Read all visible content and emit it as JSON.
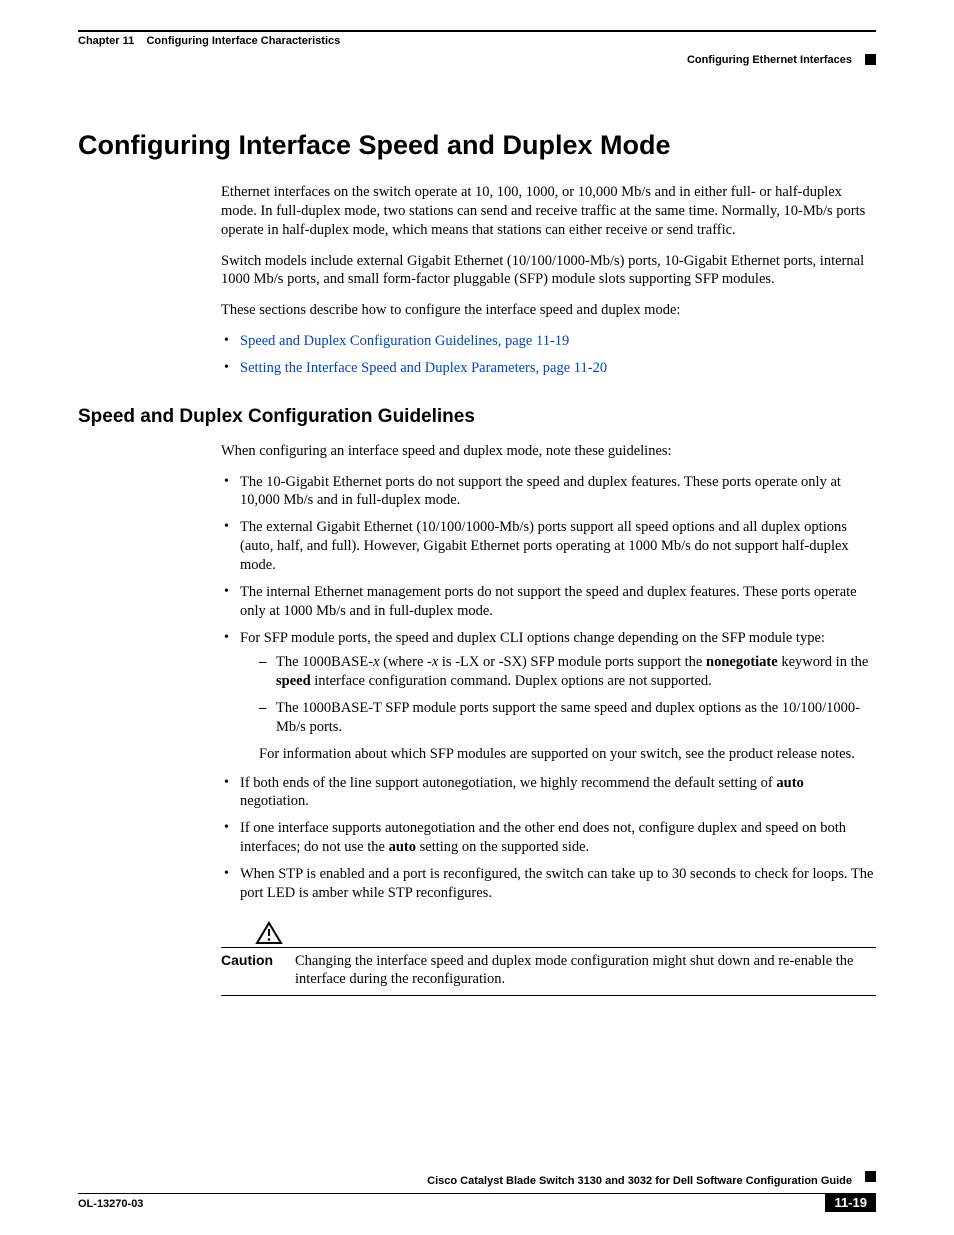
{
  "header": {
    "chapter_label": "Chapter 11",
    "chapter_title": "Configuring Interface Characteristics",
    "section_right": "Configuring Ethernet Interfaces"
  },
  "h1": "Configuring Interface Speed and Duplex Mode",
  "intro": {
    "p1": "Ethernet interfaces on the switch operate at 10, 100, 1000, or 10,000 Mb/s and in either full- or half-duplex mode. In full-duplex mode, two stations can send and receive traffic at the same time. Normally, 10-Mb/s ports operate in half-duplex mode, which means that stations can either receive or send traffic.",
    "p2": "Switch models include external Gigabit Ethernet (10/100/1000-Mb/s) ports, 10-Gigabit Ethernet ports, internal 1000 Mb/s ports, and small form-factor pluggable (SFP) module slots supporting SFP modules.",
    "p3": "These sections describe how to configure the interface speed and duplex mode:",
    "links": [
      "Speed and Duplex Configuration Guidelines, page 11-19",
      "Setting the Interface Speed and Duplex Parameters, page 11-20"
    ]
  },
  "h2": "Speed and Duplex Configuration Guidelines",
  "guide": {
    "intro": "When configuring an interface speed and duplex mode, note these guidelines:",
    "b1": "The 10-Gigabit Ethernet ports do not support the speed and duplex features. These ports operate only at 10,000 Mb/s and in full-duplex mode.",
    "b2": "The external Gigabit Ethernet (10/100/1000-Mb/s) ports support all speed options and all duplex options (auto, half, and full). However, Gigabit Ethernet ports operating at 1000 Mb/s do not support half-duplex mode.",
    "b3": "The internal Ethernet management ports do not support the speed and duplex features. These ports operate only at 1000 Mb/s and in full-duplex mode.",
    "b4": "For SFP module ports, the speed and duplex CLI options change depending on the SFP module type:",
    "b4_sub1_pre": "The 1000BASE-",
    "b4_sub1_x1": "x",
    "b4_sub1_mid1": " (where -",
    "b4_sub1_x2": "x",
    "b4_sub1_mid2": " is -LX or -SX) SFP module ports support the ",
    "b4_sub1_kw": "nonegotiate",
    "b4_sub1_mid3": " keyword in the ",
    "b4_sub1_speed": "speed",
    "b4_sub1_tail": " interface configuration command. Duplex options are not supported.",
    "b4_sub2": "The 1000BASE-T SFP module ports support the same speed and duplex options as the 10/100/1000-Mb/s ports.",
    "b4_after": "For information about which SFP modules are supported on your switch, see the product release notes.",
    "b5_pre": "If both ends of the line support autonegotiation, we highly recommend the default setting of ",
    "b5_kw": "auto",
    "b5_tail": " negotiation.",
    "b6_pre": "If one interface supports autonegotiation and the other end does not, configure duplex and speed on both interfaces; do not use the ",
    "b6_kw": "auto",
    "b6_tail": " setting on the supported side.",
    "b7": "When STP is enabled and a port is reconfigured, the switch can take up to 30 seconds to check for loops. The port LED is amber while STP reconfigures."
  },
  "caution": {
    "label": "Caution",
    "text": "Changing the interface speed and duplex mode configuration might shut down and re-enable the interface during the reconfiguration."
  },
  "footer": {
    "guide": "Cisco Catalyst Blade Switch 3130 and 3032 for Dell Software Configuration Guide",
    "docnum": "OL-13270-03",
    "page": "11-19"
  }
}
